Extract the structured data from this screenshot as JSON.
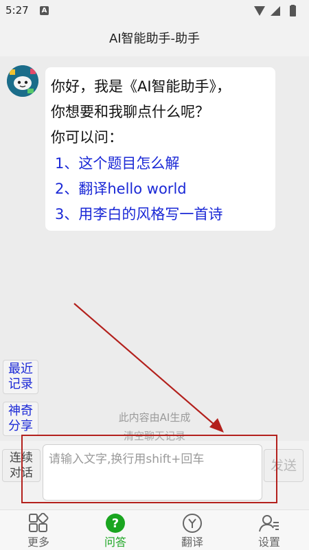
{
  "status_bar": {
    "time": "5:27",
    "badge": "A"
  },
  "header": {
    "title": "AI智能助手-助手"
  },
  "chat": {
    "bot_message": {
      "lines": [
        "你好，我是《AI智能助手》，",
        "你想要和我聊点什么呢？",
        "你可以问："
      ],
      "suggestions": [
        "1、这个题目怎么解",
        "2、翻译hello world",
        "3、用李白的风格写一首诗"
      ]
    }
  },
  "side_buttons": {
    "recent": [
      "最近",
      "记录"
    ],
    "share": [
      "神奇",
      "分享"
    ]
  },
  "notices": {
    "ai_generated": "此内容由AI生成",
    "clear_history": "清空聊天记录"
  },
  "input_bar": {
    "continuous": [
      "连续",
      "对话"
    ],
    "placeholder": "请输入文字,换行用shift+回车",
    "send_label": "发送"
  },
  "tabs": [
    {
      "label": "更多",
      "icon": "grid-icon",
      "active": false
    },
    {
      "label": "问答",
      "icon": "question-icon",
      "active": true
    },
    {
      "label": "翻译",
      "icon": "translate-icon",
      "active": false
    },
    {
      "label": "设置",
      "icon": "user-settings-icon",
      "active": false
    }
  ],
  "colors": {
    "accent": "#1aa520",
    "link": "#1a28d6",
    "annotation": "#b3201c"
  }
}
